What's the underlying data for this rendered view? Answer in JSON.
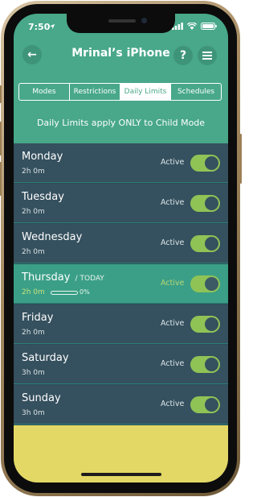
{
  "status_bar": {
    "time": "7:50"
  },
  "header": {
    "title": "Mrinal’s iPhone",
    "back_icon": "←",
    "help_label": "?",
    "menu_icon": "hamburger-menu-icon"
  },
  "tabs": [
    {
      "label": "Modes",
      "active": false
    },
    {
      "label": "Restrictions",
      "active": false
    },
    {
      "label": "Daily Limits",
      "active": true
    },
    {
      "label": "Schedules",
      "active": false
    }
  ],
  "banner": {
    "text": "Daily Limits apply ONLY to Child Mode"
  },
  "days": [
    {
      "name": "Monday",
      "time": "2h 0m",
      "status": "Active",
      "enabled": true
    },
    {
      "name": "Tuesday",
      "time": "2h 0m",
      "status": "Active",
      "enabled": true
    },
    {
      "name": "Wednesday",
      "time": "2h 0m",
      "status": "Active",
      "enabled": true
    },
    {
      "name": "Thursday",
      "today_tag": "/ TODAY",
      "time": "2h 0m",
      "progress_text": "0%",
      "progress": 0,
      "status": "Active",
      "enabled": true,
      "today": true
    },
    {
      "name": "Friday",
      "time": "2h 0m",
      "status": "Active",
      "enabled": true
    },
    {
      "name": "Saturday",
      "time": "3h 0m",
      "status": "Active",
      "enabled": true
    },
    {
      "name": "Sunday",
      "time": "3h 0m",
      "status": "Active",
      "enabled": true
    }
  ],
  "colors": {
    "header": "#48a889",
    "row": "#35505e",
    "today_row": "#3b9f87",
    "toggle_on": "#8fc356",
    "footer": "#e3d865"
  }
}
